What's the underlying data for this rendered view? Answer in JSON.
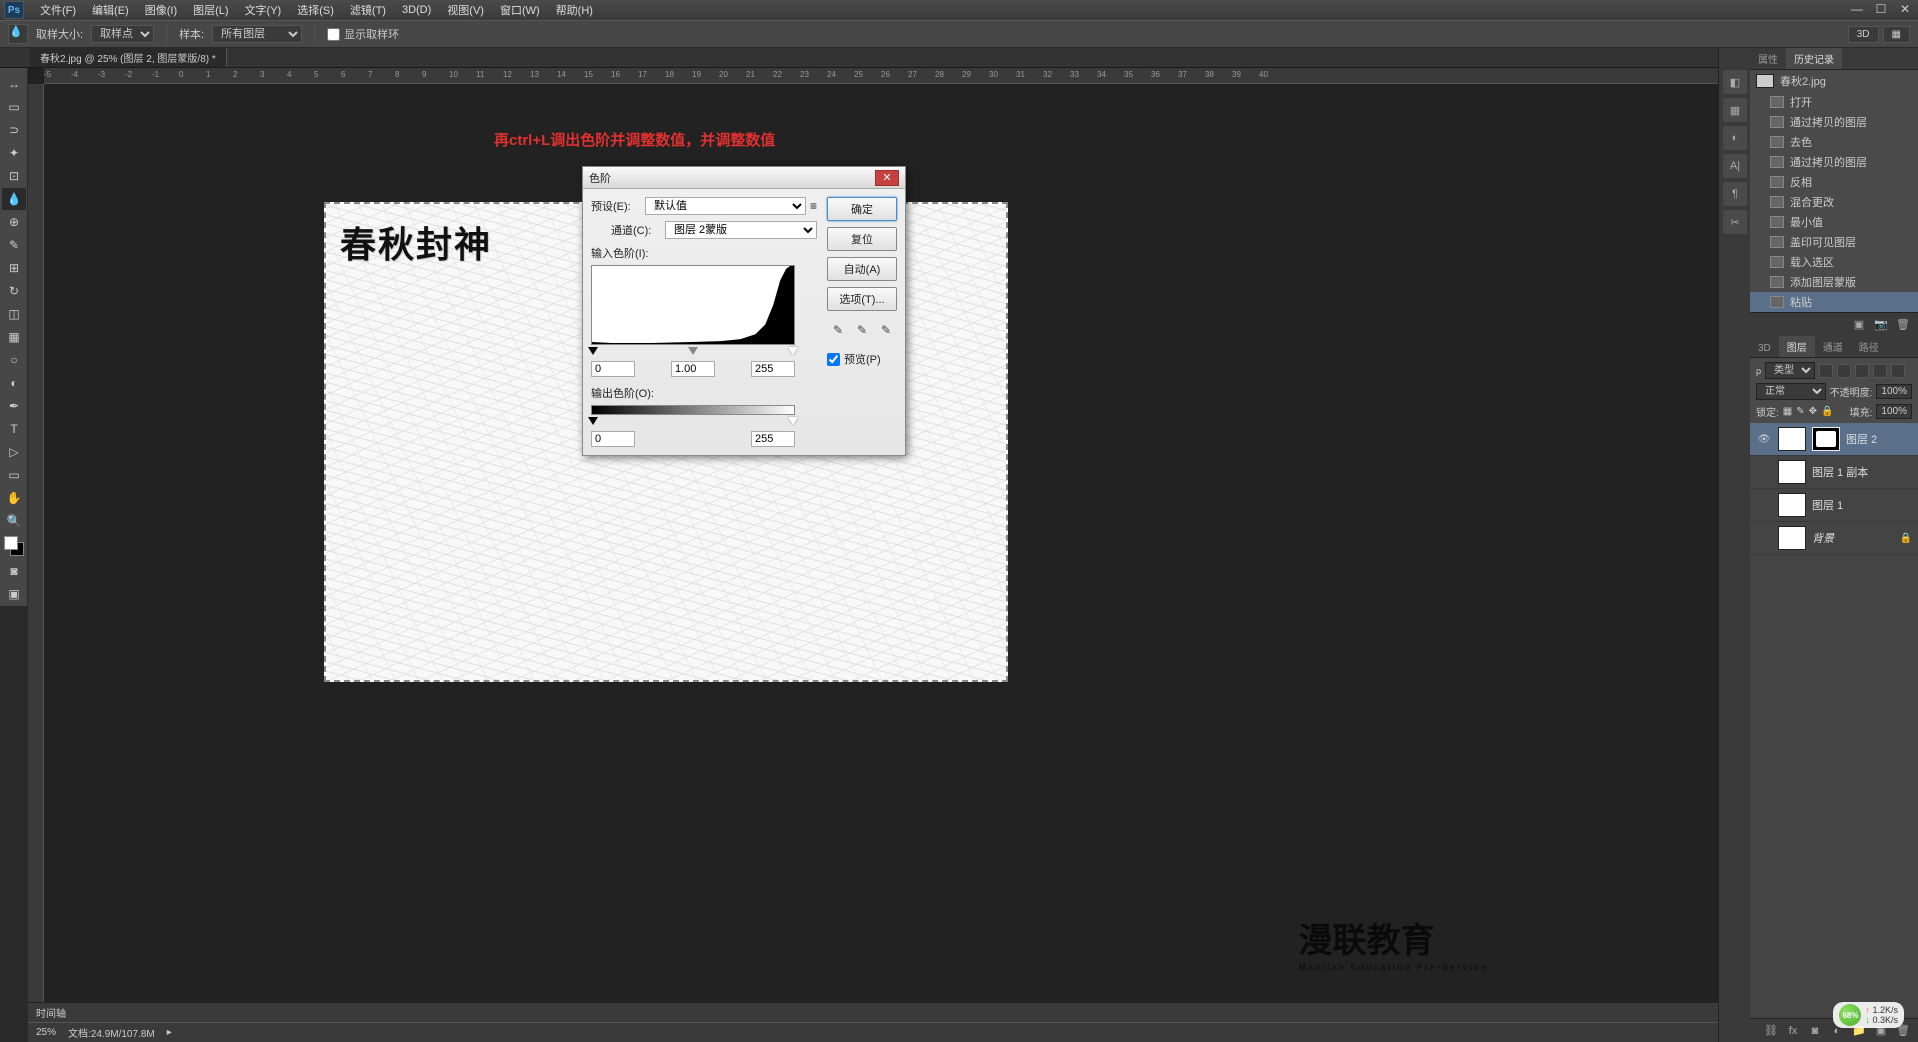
{
  "app": {
    "logo": "Ps"
  },
  "menu": {
    "items": [
      "文件(F)",
      "编辑(E)",
      "图像(I)",
      "图层(L)",
      "文字(Y)",
      "选择(S)",
      "滤镜(T)",
      "3D(D)",
      "视图(V)",
      "窗口(W)",
      "帮助(H)"
    ]
  },
  "options": {
    "sample_size_label": "取样大小:",
    "sample_size_value": "取样点",
    "sample_label": "样本:",
    "sample_value": "所有图层",
    "show_sample_ring": "显示取样环",
    "mode_3d": "3D"
  },
  "tab": {
    "title": "春秋2.jpg @ 25% (图层 2, 图层蒙版/8) *"
  },
  "ruler_marks": [
    -5,
    -4,
    -3,
    -2,
    -1,
    0,
    1,
    2,
    3,
    4,
    5,
    6,
    7,
    8,
    9,
    10,
    11,
    12,
    13,
    14,
    15,
    16,
    17,
    18,
    19,
    20,
    21,
    22,
    23,
    24,
    25,
    26,
    27,
    28,
    29,
    30,
    31,
    32,
    33,
    34,
    35,
    36,
    37,
    38,
    39,
    40
  ],
  "annotation": "再ctrl+L调出色阶并调整数值，并调整数值",
  "artwork_title": "春秋封神",
  "dialog": {
    "title": "色阶",
    "preset_label": "预设(E):",
    "preset_value": "默认值",
    "channel_label": "通道(C):",
    "channel_value": "图层 2蒙版",
    "input_levels_label": "输入色阶(I):",
    "output_levels_label": "输出色阶(O):",
    "in_black": "0",
    "in_gamma": "1.00",
    "in_white": "255",
    "out_black": "0",
    "out_white": "255",
    "btn_ok": "确定",
    "btn_cancel": "复位",
    "btn_auto": "自动(A)",
    "btn_options": "选项(T)...",
    "preview_label": "预览(P)"
  },
  "history": {
    "tab_properties": "属性",
    "tab_history": "历史记录",
    "doc_name": "春秋2.jpg",
    "items": [
      "打开",
      "通过拷贝的图层",
      "去色",
      "通过拷贝的图层",
      "反相",
      "混合更改",
      "最小值",
      "盖印可见图层",
      "载入选区",
      "添加图层蒙版",
      "粘贴"
    ]
  },
  "layers": {
    "tab_3d": "3D",
    "tab_layers": "图层",
    "tab_channels": "通道",
    "tab_paths": "路径",
    "kind_label": "类型",
    "blend_mode": "正常",
    "opacity_label": "不透明度:",
    "opacity_value": "100%",
    "lock_label": "锁定:",
    "fill_label": "填充:",
    "fill_value": "100%",
    "items": [
      {
        "name": "图层 2",
        "has_mask": true,
        "visible": true,
        "selected": true
      },
      {
        "name": "图层 1 副本",
        "has_mask": false,
        "visible": false
      },
      {
        "name": "图层 1",
        "has_mask": false,
        "visible": false
      },
      {
        "name": "背景",
        "has_mask": false,
        "visible": false,
        "locked": true,
        "italic": true
      }
    ]
  },
  "status": {
    "zoom": "25%",
    "doc_info": "文档:24.9M/107.8M",
    "timeline": "时间轴"
  },
  "network": {
    "percent": "68%",
    "up": "1.2K/s",
    "down": "0.3K/s"
  },
  "watermark": {
    "main": "漫联教育",
    "sub": "Manlian Education Pre-Service"
  },
  "tools": [
    "↕",
    "▭",
    "◯",
    "✂",
    "✎",
    "◐",
    "✒",
    "▤",
    "◧",
    "⬚",
    "◎",
    "T",
    "▷",
    "✋",
    "🔍"
  ]
}
